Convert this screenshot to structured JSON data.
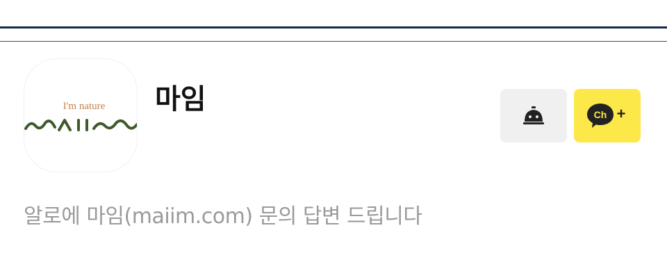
{
  "profile": {
    "name": "마임",
    "logo_tagline": "I'm nature",
    "logo_wordmark": "MAIIM",
    "description": "알로에 마임(maiim.com) 문의 답변 드립니다"
  },
  "actions": {
    "call_icon": "service-bell-icon",
    "add_channel_icon": "channel-add-icon",
    "add_channel_badge": "Ch",
    "add_channel_plus": "+"
  },
  "colors": {
    "header_border": "#0f2a4a",
    "call_button_bg": "#f0f0f0",
    "add_channel_bg": "#fde84a",
    "logo_green": "#3f5a2a",
    "logo_tagline": "#c98248",
    "description_text": "#9a9a9a"
  }
}
